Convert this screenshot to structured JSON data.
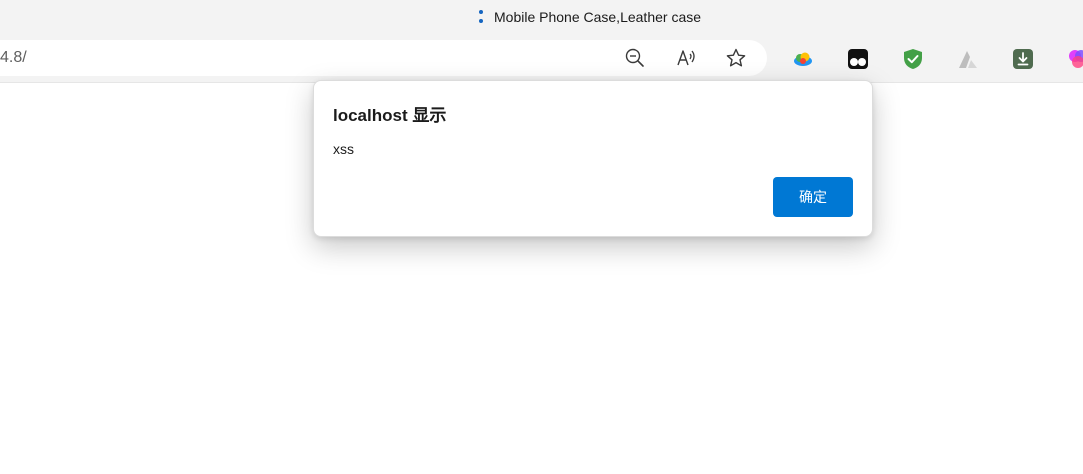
{
  "browser": {
    "tab": {
      "title": "Mobile Phone Case,Leather case",
      "favicon": "three-dot-favicon"
    },
    "address": {
      "url_visible": "4.8/"
    },
    "address_icons": [
      "zoom-out-icon",
      "read-aloud-icon",
      "favorite-star-icon"
    ],
    "extensions": [
      "cloud-extension-icon",
      "tampermonkey-extension-icon",
      "shield-check-extension-icon",
      "mountain-a-extension-icon",
      "download-extension-icon",
      "colorful-extension-icon"
    ]
  },
  "dialog": {
    "title": "localhost 显示",
    "message": "xss",
    "ok_label": "确定",
    "accent": "#0078d4"
  }
}
